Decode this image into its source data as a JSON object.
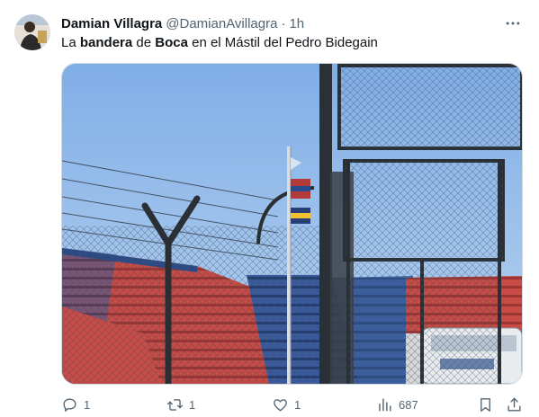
{
  "author": {
    "name": "Damian Villagra",
    "handle": "@DamianAvillagra",
    "separator": "·",
    "time": "1h",
    "avatar_icon": "avatar"
  },
  "tweet": {
    "text_parts": {
      "p1": "La ",
      "p2": "bandera",
      "p3": " de ",
      "p4": "Boca",
      "p5": " en el Mástil del Pedro Bidegain"
    }
  },
  "actions": {
    "reply_count": "1",
    "retweet_count": "1",
    "like_count": "1",
    "views_count": "687"
  },
  "colors": {
    "text_primary": "#0f1419",
    "text_secondary": "#536471",
    "border": "#cfd9de",
    "stand_red": "#c94b45",
    "stand_blue": "#2f4f8f",
    "sky": "#8fb6e8"
  }
}
